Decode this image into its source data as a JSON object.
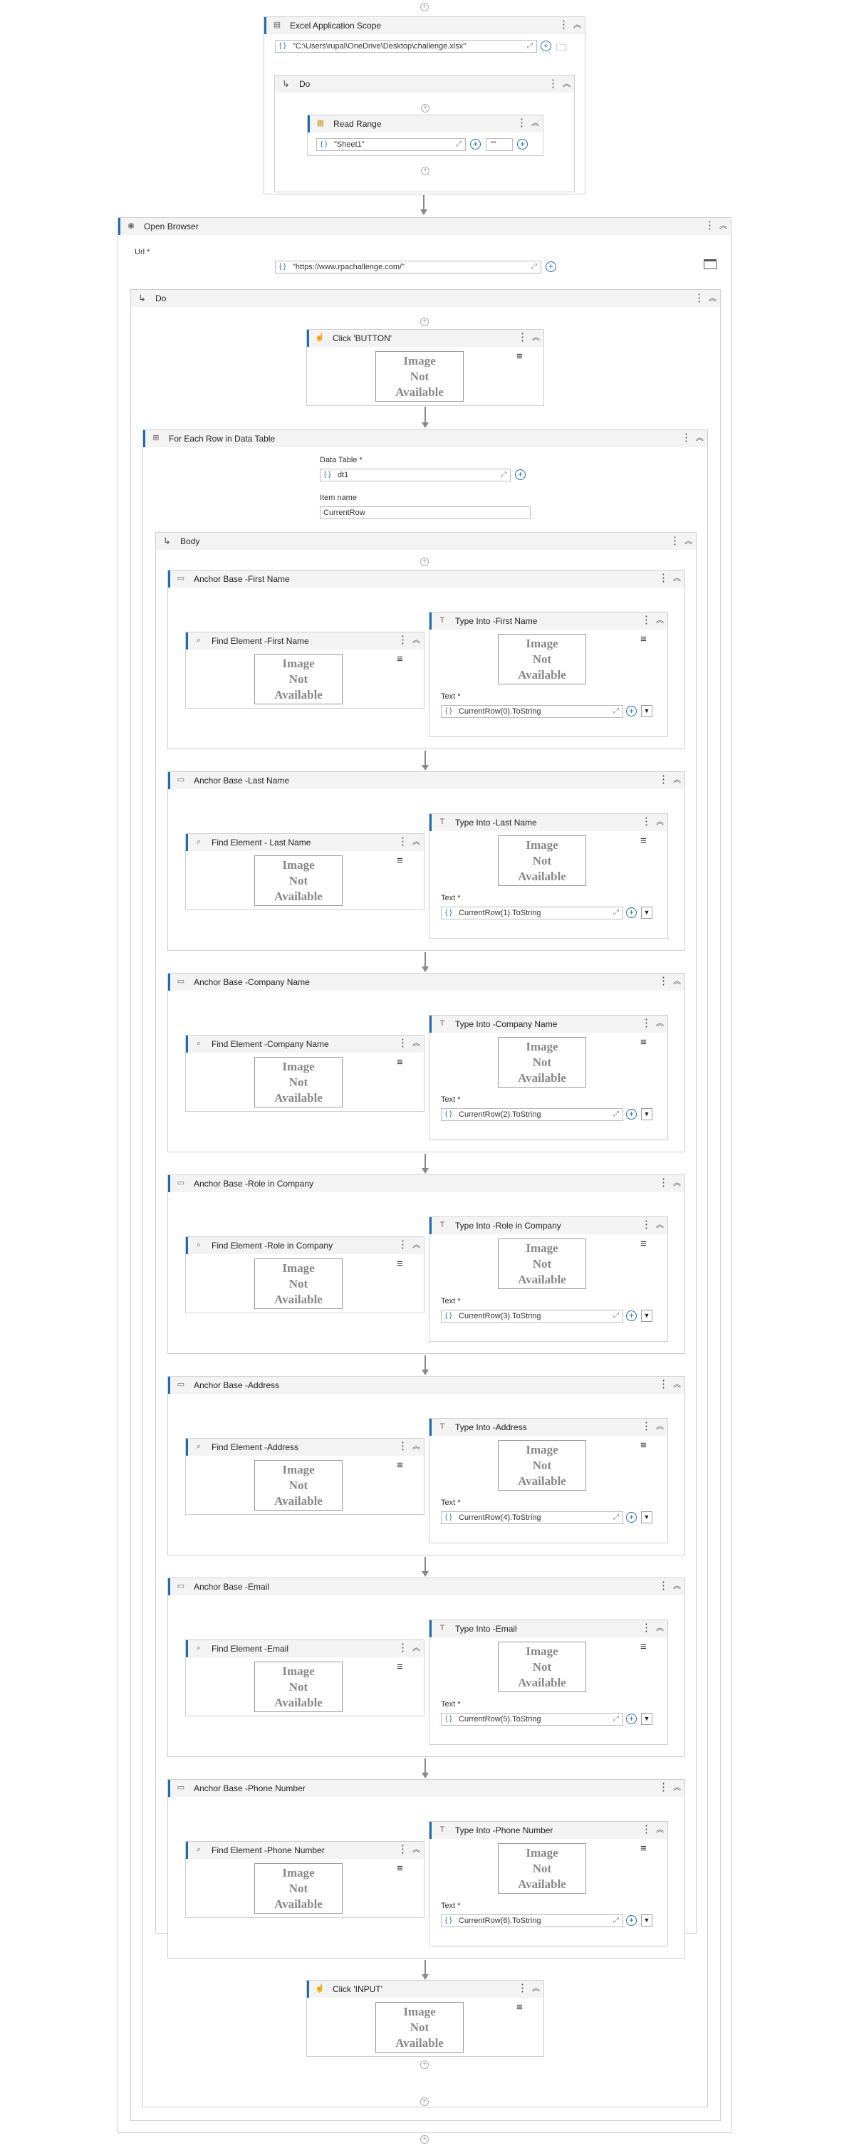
{
  "workflow": {
    "excel_scope": {
      "title": "Excel Application Scope",
      "path": "\"C:\\Users\\rupal\\OneDrive\\Desktop\\challenge.xlsx\""
    },
    "excel_do": {
      "title": "Do"
    },
    "read_range": {
      "title": "Read Range",
      "sheet": "\"Sheet1\"",
      "range": "\"\""
    },
    "open_browser": {
      "title": "Open Browser",
      "url_label": "Url *",
      "url": "\"https://www.rpachallenge.com/\""
    },
    "browser_do": {
      "title": "Do"
    },
    "click_button": {
      "title": "Click 'BUTTON'"
    },
    "for_each": {
      "title": "For Each Row in Data Table",
      "datatable_label": "Data Table *",
      "datatable": "dt1",
      "itemname_label": "Item name",
      "itemname": "CurrentRow"
    },
    "body": {
      "title": "Body"
    },
    "anchors": [
      {
        "anchor": "Anchor Base -First Name",
        "find": "Find Element -First Name",
        "type": "Type Into -First Name",
        "text_label": "Text *",
        "text": "CurrentRow(0).ToString"
      },
      {
        "anchor": "Anchor Base -Last Name",
        "find": "Find Element - Last Name",
        "type": "Type Into -Last Name",
        "text_label": "Text *",
        "text": "CurrentRow(1).ToString"
      },
      {
        "anchor": "Anchor Base -Company Name",
        "find": "Find Element -Company Name",
        "type": "Type Into -Company Name",
        "text_label": "Text *",
        "text": "CurrentRow(2).ToString"
      },
      {
        "anchor": "Anchor Base -Role in Company",
        "find": "Find Element -Role in Company",
        "type": "Type Into -Role in Company",
        "text_label": "Text *",
        "text": "CurrentRow(3).ToString"
      },
      {
        "anchor": "Anchor Base -Address",
        "find": "Find Element -Address",
        "type": "Type Into -Address",
        "text_label": "Text *",
        "text": "CurrentRow(4).ToString"
      },
      {
        "anchor": "Anchor Base -Email",
        "find": "Find Element -Email",
        "type": "Type Into -Email",
        "text_label": "Text *",
        "text": "CurrentRow(5).ToString"
      },
      {
        "anchor": "Anchor Base -Phone Number",
        "find": "Find Element -Phone Number",
        "type": "Type Into -Phone Number",
        "text_label": "Text *",
        "text": "CurrentRow(6).ToString"
      }
    ],
    "click_input": {
      "title": "Click 'INPUT'"
    },
    "image_placeholder": [
      "Image",
      "Not",
      "Available"
    ]
  },
  "icons": {
    "more": "more-vertical-icon",
    "collapse": "chevron-double-up-icon",
    "add": "plus-circle-icon",
    "expand": "expand-icon",
    "folder": "folder-icon",
    "menu": "hamburger-icon",
    "dropdown": "dropdown-icon"
  },
  "colors": {
    "accent": "#1f6bb5",
    "border": "#cfcfcf",
    "header_bg": "#f3f3f3"
  }
}
